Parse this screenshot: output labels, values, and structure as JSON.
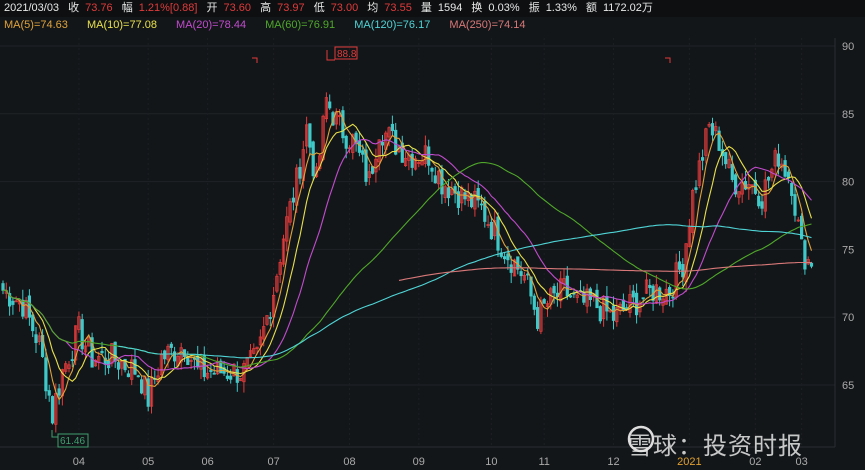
{
  "header": {
    "date": "2021/03/03",
    "close_label": "收",
    "close": "73.76",
    "chg_label": "幅",
    "chg": "1.21%[0.88]",
    "open_label": "开",
    "open": "73.60",
    "high_label": "高",
    "high": "73.97",
    "low_label": "低",
    "low": "73.00",
    "avg_label": "均",
    "avg": "73.55",
    "vol_label": "量",
    "vol": "1594",
    "turn_label": "换",
    "turn": "0.03%",
    "amp_label": "振",
    "amp": "1.33%",
    "amt_label": "额",
    "amt": "1172.02万"
  },
  "ma_legend": [
    {
      "label": "MA(5)=74.63",
      "color": "#e0a33a"
    },
    {
      "label": "MA(10)=77.08",
      "color": "#e8e04a"
    },
    {
      "label": "MA(20)=78.44",
      "color": "#c24ccf"
    },
    {
      "label": "MA(60)=76.91",
      "color": "#4fa82a"
    },
    {
      "label": "MA(120)=76.17",
      "color": "#4fd4d6"
    },
    {
      "label": "MA(250)=74.14",
      "color": "#d87878"
    }
  ],
  "watermark": "雪球：投资时报",
  "chart_data": {
    "type": "candlestick",
    "ylim": [
      61,
      91
    ],
    "y_ticks": [
      "90",
      "85",
      "80",
      "75",
      "70",
      "65"
    ],
    "x_ticks": [
      {
        "label": "04",
        "day": 23
      },
      {
        "label": "05",
        "day": 44
      },
      {
        "label": "06",
        "day": 62
      },
      {
        "label": "07",
        "day": 82
      },
      {
        "label": "08",
        "day": 105
      },
      {
        "label": "09",
        "day": 126
      },
      {
        "label": "10",
        "day": 148
      },
      {
        "label": "11",
        "day": 164
      },
      {
        "label": "12",
        "day": 185
      },
      {
        "label": "2021",
        "day": 208,
        "highlight": true
      },
      {
        "label": "02",
        "day": 228
      },
      {
        "label": "03",
        "day": 242
      }
    ],
    "close_anchors": [
      [
        0,
        72
      ],
      [
        6,
        71
      ],
      [
        11,
        68
      ],
      [
        15,
        63
      ],
      [
        18,
        66
      ],
      [
        23,
        69
      ],
      [
        27,
        67
      ],
      [
        33,
        67
      ],
      [
        41,
        66
      ],
      [
        44,
        64
      ],
      [
        48,
        67
      ],
      [
        55,
        68
      ],
      [
        59,
        66
      ],
      [
        65,
        66
      ],
      [
        73,
        66
      ],
      [
        77,
        67
      ],
      [
        82,
        72
      ],
      [
        85,
        76
      ],
      [
        89,
        80
      ],
      [
        92,
        84
      ],
      [
        95,
        80
      ],
      [
        98,
        86
      ],
      [
        102,
        84
      ],
      [
        106,
        83
      ],
      [
        111,
        80
      ],
      [
        114,
        84
      ],
      [
        118,
        83
      ],
      [
        123,
        82
      ],
      [
        129,
        82
      ],
      [
        133,
        80
      ],
      [
        139,
        79
      ],
      [
        145,
        78
      ],
      [
        152,
        75
      ],
      [
        158,
        73
      ],
      [
        162,
        70
      ],
      [
        165,
        71
      ],
      [
        170,
        72
      ],
      [
        174,
        71
      ],
      [
        179,
        71
      ],
      [
        185,
        70
      ],
      [
        191,
        71
      ],
      [
        197,
        72
      ],
      [
        202,
        72
      ],
      [
        206,
        74
      ],
      [
        209,
        79
      ],
      [
        214,
        84
      ],
      [
        217,
        83
      ],
      [
        221,
        80
      ],
      [
        226,
        80
      ],
      [
        230,
        79
      ],
      [
        235,
        82
      ],
      [
        239,
        80
      ],
      [
        242,
        75
      ],
      [
        245,
        73.76
      ]
    ],
    "high_marker": "88.8",
    "low_marker": "61.46",
    "up_color": "#e03b3b",
    "down_color": "#3fc9c9"
  }
}
